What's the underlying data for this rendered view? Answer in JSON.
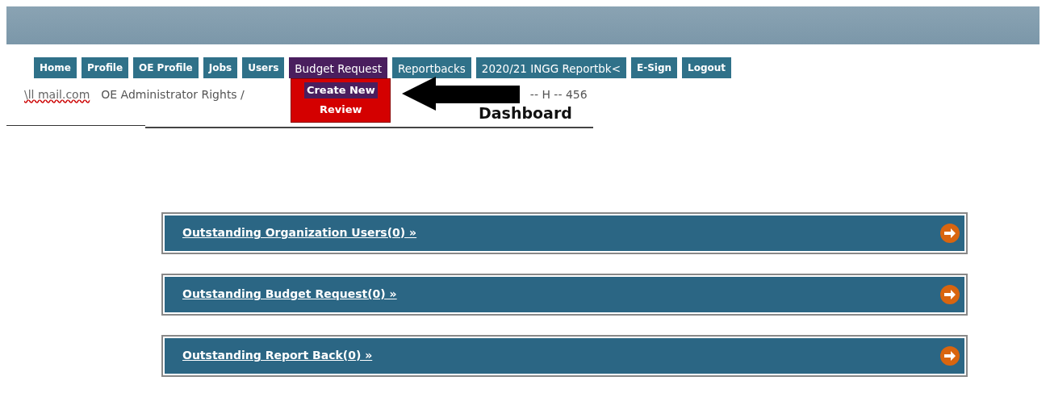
{
  "nav": [
    {
      "label": "Home",
      "selected": false
    },
    {
      "label": "Profile",
      "selected": false
    },
    {
      "label": "OE Profile",
      "selected": false
    },
    {
      "label": "Jobs",
      "selected": false
    },
    {
      "label": "Users",
      "selected": false
    },
    {
      "label": "Budget Request",
      "selected": true,
      "menu": [
        {
          "label": "Create New",
          "selected": true
        },
        {
          "label": "Review",
          "selected": false
        }
      ]
    },
    {
      "label": "Reportbacks",
      "selected": false
    },
    {
      "label": "2020/21 INGG Reportbk<",
      "selected": false
    },
    {
      "label": "E-Sign",
      "selected": false
    },
    {
      "label": "Logout",
      "selected": false
    }
  ],
  "breadcrumb": {
    "email": "\\ll mail.com",
    "role": "OE Administrator Rights /",
    "code": "-- H -- 456"
  },
  "title": "Dashboard",
  "panels": [
    {
      "label": "Outstanding Organization Users(0) »"
    },
    {
      "label": "Outstanding Budget Request(0) »"
    },
    {
      "label": "Outstanding Report Back(0) »"
    }
  ]
}
